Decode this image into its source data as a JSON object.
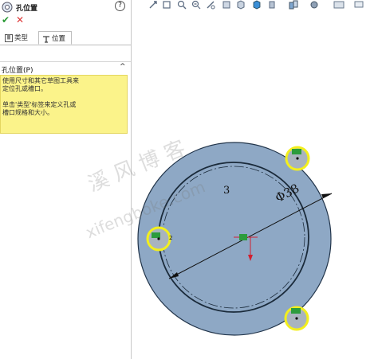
{
  "panel": {
    "title": "孔位置",
    "help": "?",
    "ok": "✔",
    "cancel": "✕",
    "tabs": [
      {
        "label": "类型"
      },
      {
        "label": "位置"
      }
    ],
    "section": {
      "label": "孔位置(P)",
      "chevron": "^"
    },
    "message_line1": "使用尺寸和其它草图工具来",
    "message_line2": "定位孔或槽口。",
    "message_line3": "单击'类型'标签来定义孔或",
    "message_line4": "槽口规格和大小。"
  },
  "viewport": {
    "note_number": "3",
    "diameter_label": "Φ38",
    "watermark_cn": "溪 风 博 客",
    "watermark_en": "xifengboke.com",
    "point_tag": "2",
    "colors": {
      "disk": "#8ea8c5",
      "hole_highlight": "#f3ef1c",
      "point": "#2c9c3c"
    }
  }
}
